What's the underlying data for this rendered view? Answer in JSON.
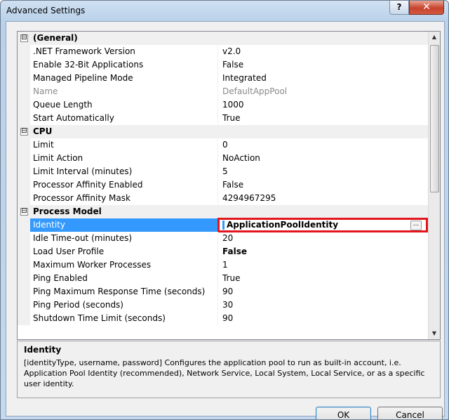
{
  "window": {
    "title": "Advanced Settings",
    "help_glyph": "?",
    "close_glyph": "✕"
  },
  "grid": {
    "rows": [
      {
        "kind": "category",
        "toggle": "⊟",
        "name": "(General)",
        "value": ""
      },
      {
        "kind": "prop",
        "name": ".NET Framework Version",
        "value": "v2.0"
      },
      {
        "kind": "prop",
        "name": "Enable 32-Bit Applications",
        "value": "False"
      },
      {
        "kind": "prop",
        "name": "Managed Pipeline Mode",
        "value": "Integrated"
      },
      {
        "kind": "prop",
        "name": "Name",
        "value": "DefaultAppPool",
        "dim": true
      },
      {
        "kind": "prop",
        "name": "Queue Length",
        "value": "1000"
      },
      {
        "kind": "prop",
        "name": "Start Automatically",
        "value": "True"
      },
      {
        "kind": "category",
        "toggle": "⊟",
        "name": "CPU",
        "value": ""
      },
      {
        "kind": "prop",
        "name": "Limit",
        "value": "0"
      },
      {
        "kind": "prop",
        "name": "Limit Action",
        "value": "NoAction"
      },
      {
        "kind": "prop",
        "name": "Limit Interval (minutes)",
        "value": "5"
      },
      {
        "kind": "prop",
        "name": "Processor Affinity Enabled",
        "value": "False"
      },
      {
        "kind": "prop",
        "name": "Processor Affinity Mask",
        "value": "4294967295"
      },
      {
        "kind": "category",
        "toggle": "⊟",
        "name": "Process Model",
        "value": ""
      },
      {
        "kind": "prop",
        "name": "Identity",
        "value": "ApplicationPoolIdentity",
        "selected": true
      },
      {
        "kind": "prop",
        "name": "Idle Time-out (minutes)",
        "value": "20"
      },
      {
        "kind": "prop",
        "name": "Load User Profile",
        "value": "False",
        "bold": true
      },
      {
        "kind": "prop",
        "name": "Maximum Worker Processes",
        "value": "1"
      },
      {
        "kind": "prop",
        "name": "Ping Enabled",
        "value": "True"
      },
      {
        "kind": "prop",
        "name": "Ping Maximum Response Time (seconds)",
        "value": "90"
      },
      {
        "kind": "prop",
        "name": "Ping Period (seconds)",
        "value": "30"
      },
      {
        "kind": "prop",
        "name": "Shutdown Time Limit (seconds)",
        "value": "90"
      }
    ],
    "ellipsis_button": "...",
    "highlight_color": "#e3161d",
    "selection_color": "#3399ff"
  },
  "scrollbar": {
    "up_glyph": "▲",
    "down_glyph": "▼",
    "grip_glyph": "≡"
  },
  "description": {
    "title": "Identity",
    "text": "[identityType, username, password] Configures the application pool to run as built-in account, i.e. Application Pool Identity (recommended), Network Service, Local System, Local Service, or as a specific user identity."
  },
  "buttons": {
    "ok": "OK",
    "cancel": "Cancel"
  }
}
